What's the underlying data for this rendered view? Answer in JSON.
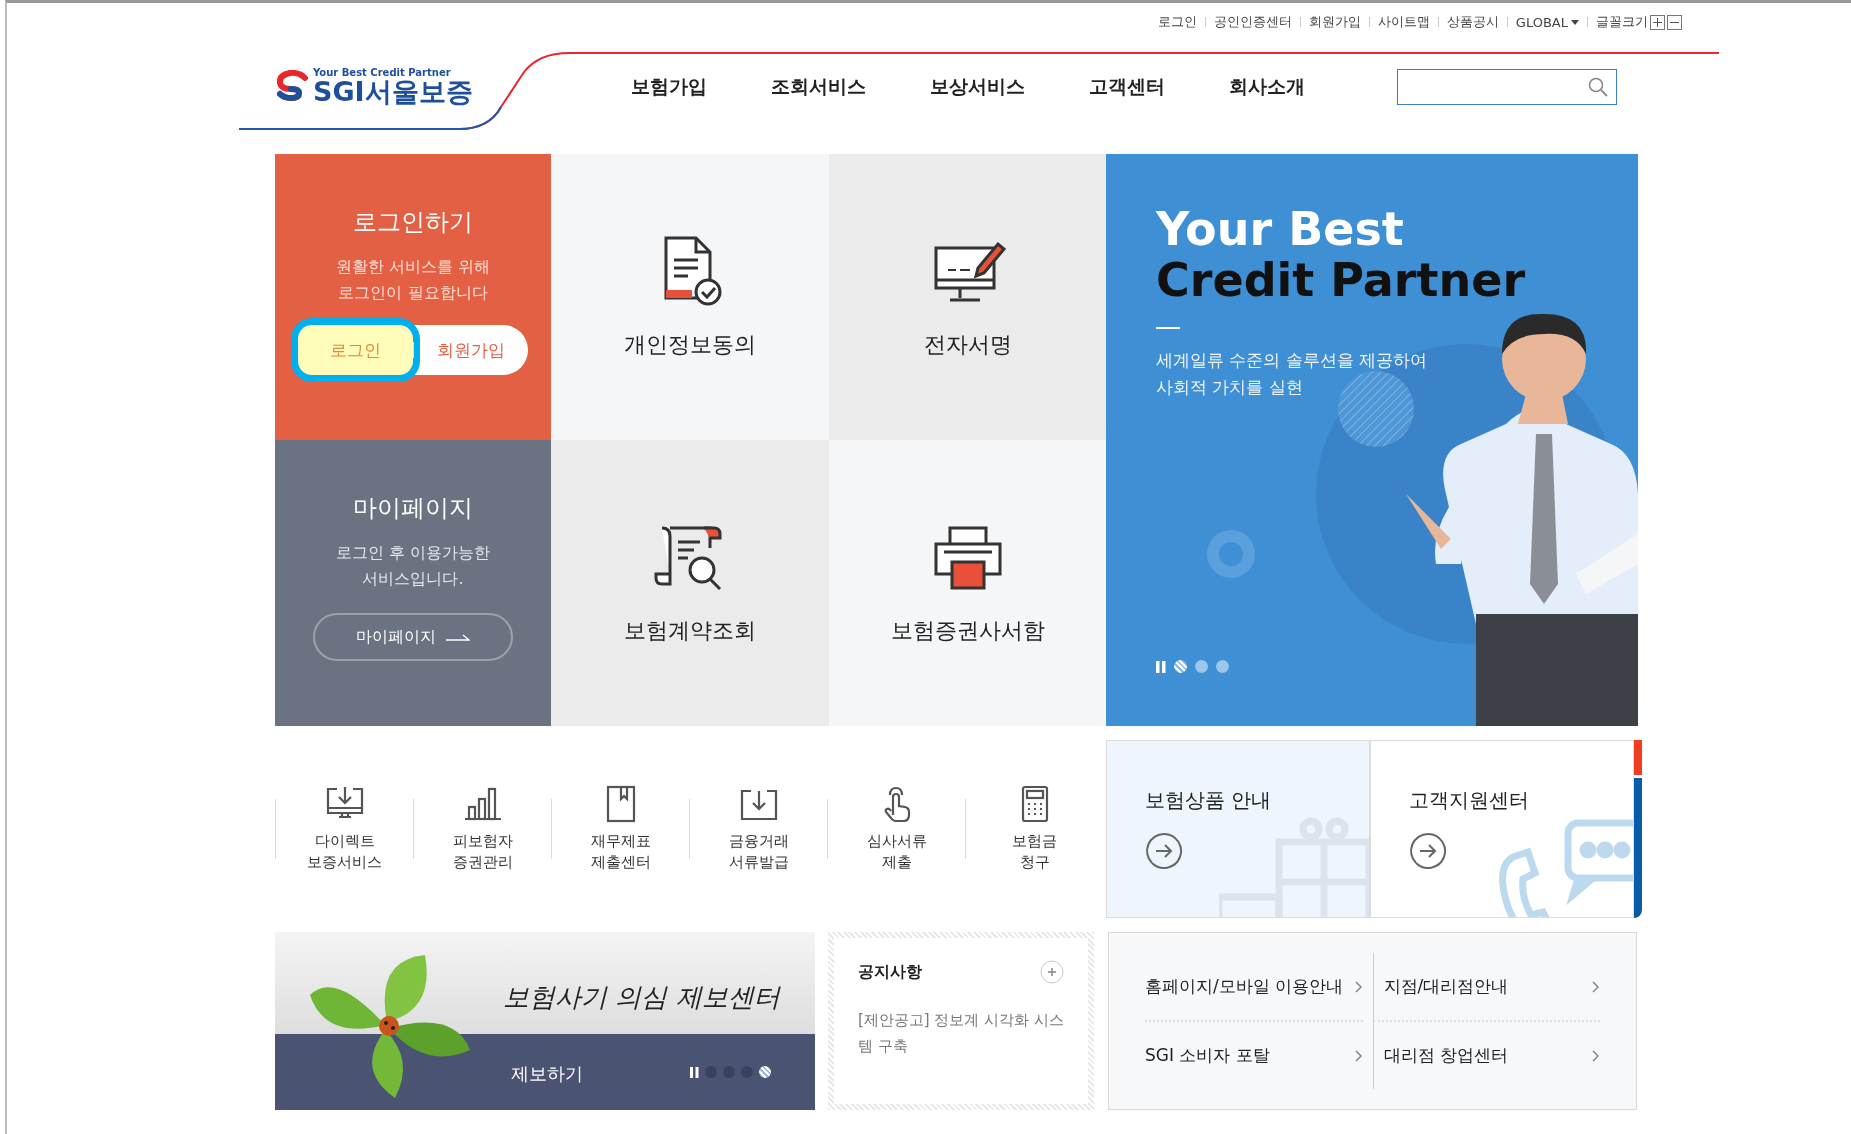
{
  "utility_links": [
    {
      "label": "로그인"
    },
    {
      "label": "공인인증센터"
    },
    {
      "label": "회원가입"
    },
    {
      "label": "사이트맵"
    },
    {
      "label": "상품공시"
    }
  ],
  "global_menu": {
    "label": "GLOBAL"
  },
  "font_size": {
    "label": "글꼴크기"
  },
  "logo": {
    "tagline": "Your Best Credit Partner",
    "name": "SGI서울보증"
  },
  "nav": [
    {
      "label": "보험가입"
    },
    {
      "label": "조회서비스"
    },
    {
      "label": "보상서비스"
    },
    {
      "label": "고객센터"
    },
    {
      "label": "회사소개"
    }
  ],
  "login_tile": {
    "title": "로그인하기",
    "message": "원활한 서비스를 위해\n로그인이 필요합니다",
    "buttons": [
      {
        "label": "로그인",
        "highlighted": true
      },
      {
        "label": "회원가입",
        "highlighted": false
      }
    ]
  },
  "mypage_tile": {
    "title": "마이페이지",
    "message": "로그인 후 이용가능한\n서비스입니다.",
    "button": "마이페이지"
  },
  "service_tiles": [
    {
      "label": "개인정보동의",
      "kind": "document"
    },
    {
      "label": "전자서명",
      "kind": "monitor"
    },
    {
      "label": "보험계약조회",
      "kind": "scroll"
    },
    {
      "label": "보험증권사서함",
      "kind": "printer"
    }
  ],
  "hero": {
    "headline": [
      "Your Best",
      "Credit Partner"
    ],
    "subtitle": "세계일류 수준의 솔루션을 제공하여\n사회적 가치를 실현",
    "slides": [
      {
        "selected": true
      },
      {
        "selected": false
      },
      {
        "selected": false
      }
    ]
  },
  "quick_menu": [
    {
      "label": "다이렉트\n보증서비스",
      "kind": "monitor-download"
    },
    {
      "label": "피보험자\n증권관리",
      "kind": "bars"
    },
    {
      "label": "재무제표\n제출센터",
      "kind": "book"
    },
    {
      "label": "금융거래\n서류발급",
      "kind": "tray-download"
    },
    {
      "label": "심사서류\n제출",
      "kind": "hand"
    },
    {
      "label": "보험금\n청구",
      "kind": "calculator"
    }
  ],
  "cards": [
    {
      "title": "보험상품 안내",
      "kind": "gift"
    },
    {
      "title": "고객지원센터",
      "kind": "phone"
    }
  ],
  "report_banner": {
    "title": "보험사기 의심 제보센터",
    "button": "제보하기",
    "slides": [
      {
        "selected": false
      },
      {
        "selected": false
      },
      {
        "selected": false
      },
      {
        "selected": true
      }
    ]
  },
  "notice": {
    "title": "공지사항",
    "items": [
      "[제안공고] 정보계 시각화 시스템 구축"
    ]
  },
  "links": [
    {
      "label": "홈페이지/모바일 이용안내"
    },
    {
      "label": "지점/대리점안내"
    },
    {
      "label": "SGI 소비자 포탈"
    },
    {
      "label": "대리점 창업센터"
    }
  ]
}
